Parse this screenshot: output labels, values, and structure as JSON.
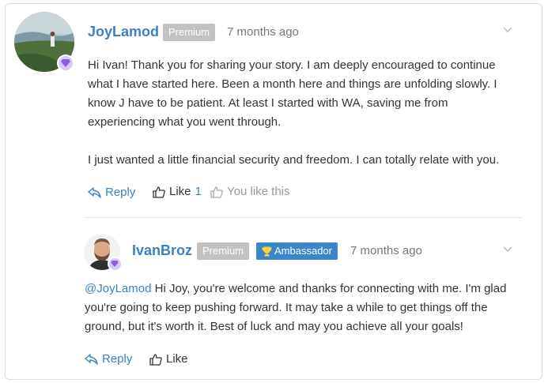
{
  "comment1": {
    "author": "JoyLamod",
    "badge": "Premium",
    "time": "7 months ago",
    "paragraph1": "Hi Ivan! Thank you for sharing your story. I am deeply encouraged to continue what I have started here. Been a month here and things are unfolding slowly. I know J have to be patient. At least I started with WA, saving me from experiencing what you went through.",
    "paragraph2": "I just wanted a little financial security and freedom. I can totally relate with you.",
    "reply_label": "Reply",
    "like_label": "Like",
    "like_count": "1",
    "you_like_label": "You like this"
  },
  "comment2": {
    "author": "IvanBroz",
    "badge_premium": "Premium",
    "badge_ambassador": "Ambassador",
    "time": "7 months ago",
    "mention": "@JoyLamod",
    "body": " Hi Joy, you're welcome and thanks for connecting with me. I'm glad you're going to keep pushing forward. It may take a while to get things off the ground, but it's worth it. Best of luck and may you achieve all your goals!",
    "reply_label": "Reply",
    "like_label": "Like"
  },
  "colors": {
    "link": "#3b82c4",
    "premium": "#c2c2c2",
    "ambassador": "#3b86c8"
  }
}
